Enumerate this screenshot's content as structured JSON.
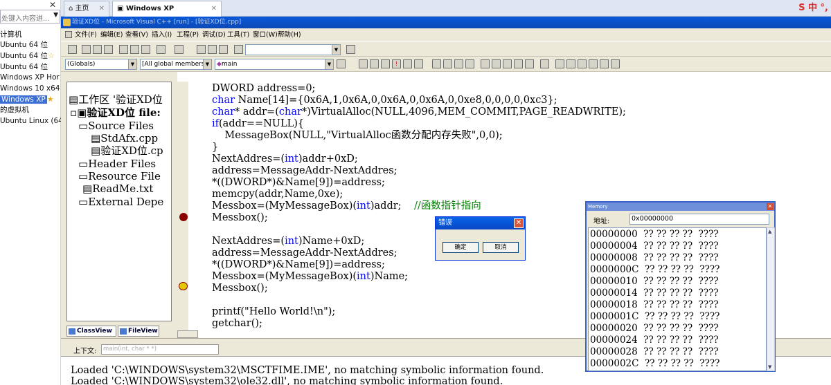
{
  "vm_sidebar": {
    "search_placeholder": "处键入内容进...",
    "items": [
      {
        "label": "计算机"
      },
      {
        "label": "Ubuntu 64 位"
      },
      {
        "label": "Ubuntu 64 位"
      },
      {
        "label": "Ubuntu 64 位"
      },
      {
        "label": "Windows XP Hor"
      },
      {
        "label": "Windows 10 x64"
      },
      {
        "label": "Windows XP"
      },
      {
        "label": "的虚拟机"
      },
      {
        "label": "Ubuntu Linux (64"
      }
    ]
  },
  "tabs": [
    {
      "label": "主页"
    },
    {
      "label": "Windows XP Professional"
    }
  ],
  "ime_indicator": "中 °,",
  "vc": {
    "title": "验证XD位 - Microsoft Visual C++ [run] - [验证XD位.cpp]",
    "menus": [
      "文件(F)",
      "编辑(E)",
      "查看(V)",
      "插入(I)",
      "工程(P)",
      "调试(D)",
      "工具(T)",
      "窗口(W)",
      "帮助(H)"
    ],
    "combo_globals": "(Globals)",
    "combo_members": "[All global members",
    "combo_function": "main"
  },
  "workspace": {
    "root": "工作区 '验证XD位",
    "project": "验证XD位 file:",
    "nodes": [
      "Source Files",
      "StdAfx.cpp",
      "验证XD位.cp",
      "Header Files",
      "Resource File",
      "ReadMe.txt",
      "External Depe"
    ],
    "tab_classview": "ClassView",
    "tab_fileview": "FileView"
  },
  "code": {
    "l1": "DWORD address=0;",
    "l2_kw": "char",
    "l2": " Name[14]={0x6A,1,0x6A,0,0x6A,0,0x6A,0,0xe8,0,0,0,0,0xc3};",
    "l3_kw": "char",
    "l3a": "* addr=(",
    "l3_kw2": "char",
    "l3b": "*)VirtualAlloc(NULL,4096,MEM_COMMIT,PAGE_READWRITE);",
    "l4_kw": "if",
    "l4": "(addr==NULL){",
    "l5": "    MessageBox(NULL,\"VirtualAlloc函数分配内存失败\",0,0);",
    "l6": "}",
    "l7a": "NextAddres=(",
    "l7_kw": "int",
    "l7b": ")addr+0xD;",
    "l8": "address=MessageAddr-NextAddres;",
    "l9": "*((DWORD*)&Name[9])=address;",
    "l10": "memcpy(addr,Name,0xe);",
    "l11a": "Messbox=(MyMessageBox)(",
    "l11_kw": "int",
    "l11b": ")addr;",
    "l11_cm": "//函数指针指向",
    "l12": "Messbox();",
    "l13a": "NextAddres=(",
    "l13_kw": "int",
    "l13b": ")Name+0xD;",
    "l14": "address=MessageAddr-NextAddres;",
    "l15": "*((DWORD*)&Name[9])=address;",
    "l16a": "Messbox=(MyMessageBox)(",
    "l16_kw": "int",
    "l16b": ")Name;",
    "l17": "Messbox();",
    "l18": "printf(\"Hello World!\\n\");",
    "l19": "getchar();"
  },
  "output": {
    "context_label": "上下文:",
    "context_value": "main(int, char * *)",
    "line1": "Loaded 'C:\\WINDOWS\\system32\\MSCTFIME.IME', no matching symbolic information found.",
    "line2": "Loaded 'C:\\WINDOWS\\system32\\ole32.dll', no matching symbolic information found."
  },
  "error_dialog": {
    "title": "错误",
    "ok": "确定",
    "cancel": "取消"
  },
  "memory": {
    "title": "Memory",
    "address_label": "地址:",
    "address_value": "0x00000000",
    "rows": [
      "00000000  ?? ?? ?? ??  ????",
      "00000004  ?? ?? ?? ??  ????",
      "00000008  ?? ?? ?? ??  ????",
      "0000000C  ?? ?? ?? ??  ????",
      "00000010  ?? ?? ?? ??  ????",
      "00000014  ?? ?? ?? ??  ????",
      "00000018  ?? ?? ?? ??  ????",
      "0000001C  ?? ?? ?? ??  ????",
      "00000020  ?? ?? ?? ??  ????",
      "00000024  ?? ?? ?? ??  ????",
      "00000028  ?? ?? ?? ??  ????",
      "0000002C  ?? ?? ?? ??  ????"
    ]
  },
  "colors": {
    "keyword": "#0000ff",
    "comment": "#008000",
    "selection": "#3b6fd4",
    "breakpoint": "#8b0000"
  }
}
